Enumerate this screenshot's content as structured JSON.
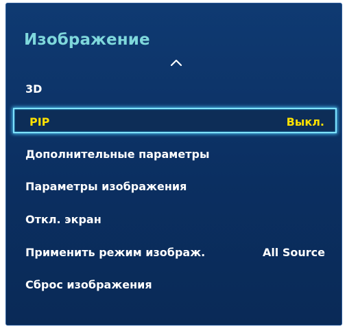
{
  "menu": {
    "title": "Изображение",
    "items": [
      {
        "label": "3D",
        "value": ""
      },
      {
        "label": "PIP",
        "value": "Выкл."
      },
      {
        "label": "Дополнительные параметры",
        "value": ""
      },
      {
        "label": "Параметры изображения",
        "value": ""
      },
      {
        "label": "Откл. экран",
        "value": ""
      },
      {
        "label": "Применить режим изображ.",
        "value": "All Source"
      },
      {
        "label": "Сброс изображения",
        "value": ""
      }
    ]
  },
  "colors": {
    "panel_background": "#0b2f61",
    "title": "#7fd8dc",
    "selected_text": "#ffe100",
    "selection_border": "#7fe3ff"
  }
}
